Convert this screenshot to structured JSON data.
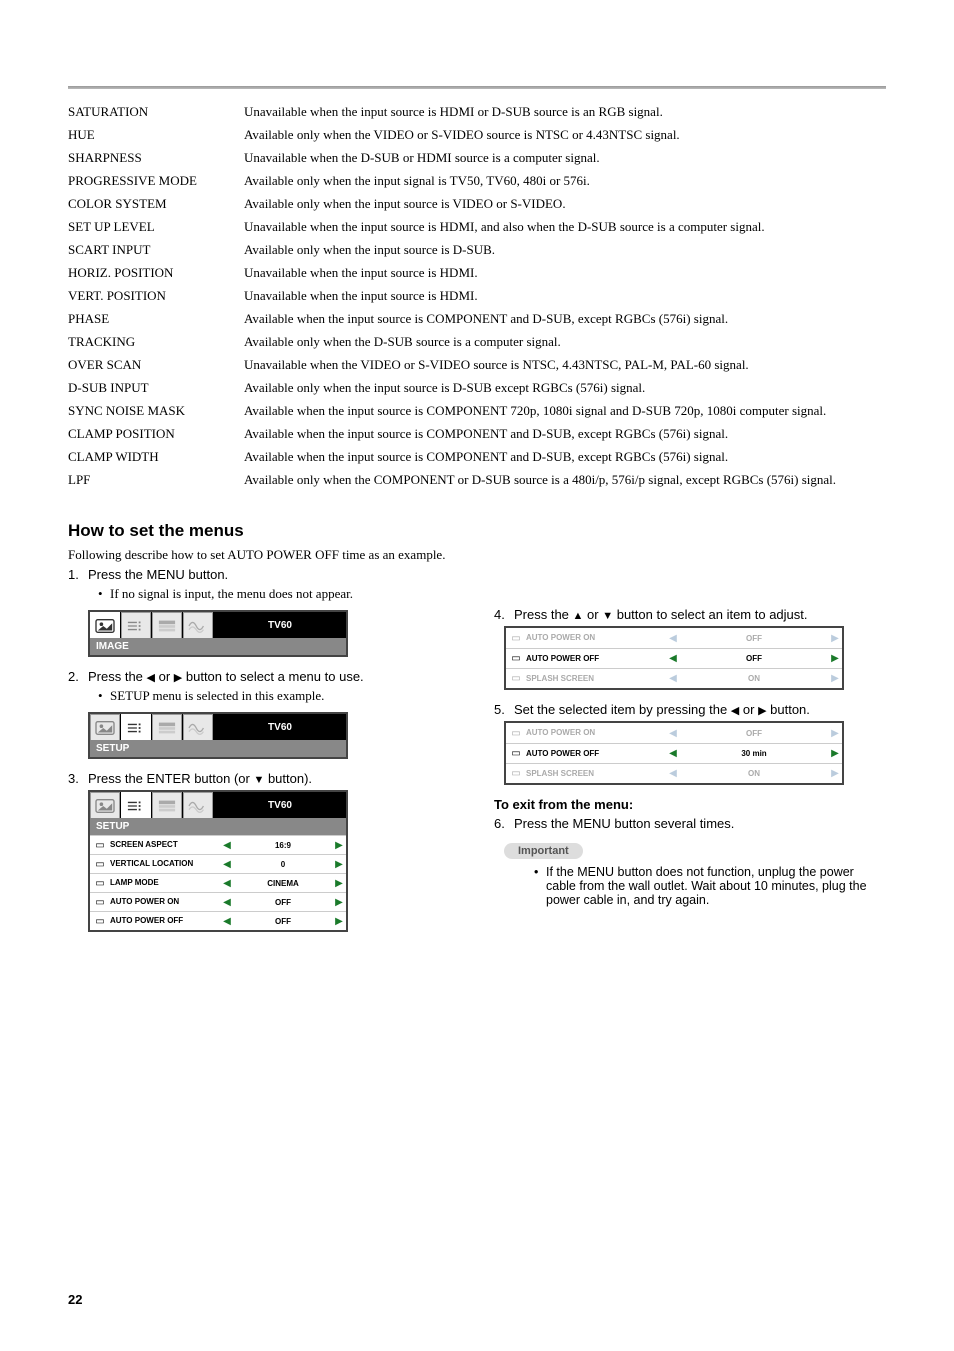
{
  "specs": [
    {
      "key": "SATURATION",
      "val": "Unavailable when the input source is HDMI or D-SUB source is an RGB signal."
    },
    {
      "key": "HUE",
      "val": "Available only when the VIDEO or S-VIDEO source is NTSC or 4.43NTSC signal."
    },
    {
      "key": "SHARPNESS",
      "val": "Unavailable when the D-SUB or HDMI source is a computer signal."
    },
    {
      "key": "PROGRESSIVE MODE",
      "val": "Available only when the input signal is TV50, TV60, 480i or 576i."
    },
    {
      "key": "COLOR SYSTEM",
      "val": "Available only when the input source is VIDEO or S-VIDEO."
    },
    {
      "key": "SET UP LEVEL",
      "val": "Unavailable when the input source is HDMI, and also when the D-SUB source is a computer signal."
    },
    {
      "key": "SCART INPUT",
      "val": "Available only when the input source is D-SUB."
    },
    {
      "key": "HORIZ. POSITION",
      "val": "Unavailable when the input source is HDMI."
    },
    {
      "key": "VERT. POSITION",
      "val": "Unavailable when the input source is HDMI."
    },
    {
      "key": "PHASE",
      "val": "Available when the input source is COMPONENT and D-SUB, except RGBCs (576i) signal."
    },
    {
      "key": "TRACKING",
      "val": "Available only when the D-SUB source is a computer signal."
    },
    {
      "key": "OVER SCAN",
      "val": "Unavailable when the VIDEO or S-VIDEO source is NTSC, 4.43NTSC, PAL-M, PAL-60 signal."
    },
    {
      "key": "D-SUB INPUT",
      "val": "Available only when the input source is D-SUB except RGBCs (576i) signal."
    },
    {
      "key": "SYNC NOISE MASK",
      "val": "Available when the input source is COMPONENT 720p, 1080i signal and D-SUB 720p, 1080i computer signal."
    },
    {
      "key": "CLAMP POSITION",
      "val": "Available when the input source is COMPONENT and D-SUB, except RGBCs (576i) signal."
    },
    {
      "key": "CLAMP WIDTH",
      "val": "Available when the input source is COMPONENT and D-SUB, except RGBCs (576i) signal."
    },
    {
      "key": "LPF",
      "val": "Available only when the COMPONENT or D-SUB source is a 480i/p, 576i/p signal, except RGBCs (576i) signal."
    }
  ],
  "how": {
    "title": "How to set the menus",
    "intro": "Following describe how to set AUTO POWER OFF time as an example.",
    "step1": {
      "num": "1.",
      "text": "Press the MENU button.",
      "note": "If no signal is input, the menu does not appear."
    },
    "osd1": {
      "tablabel": "TV60",
      "bar": "IMAGE"
    },
    "step2": {
      "num": "2.",
      "text_a": "Press the ",
      "text_b": " or ",
      "text_c": " button to select a menu to use.",
      "note": "SETUP menu is selected in this example."
    },
    "osd2": {
      "tablabel": "TV60",
      "bar": "SETUP"
    },
    "step3": {
      "num": "3.",
      "text_a": "Press the ENTER button (or ",
      "text_b": " button)."
    },
    "osd3": {
      "tablabel": "TV60",
      "bar": "SETUP",
      "rows": [
        {
          "label": "SCREEN ASPECT",
          "val": "16:9"
        },
        {
          "label": "VERTICAL LOCATION",
          "val": "0"
        },
        {
          "label": "LAMP MODE",
          "val": "CINEMA"
        },
        {
          "label": "AUTO POWER ON",
          "val": "OFF"
        },
        {
          "label": "AUTO POWER OFF",
          "val": "OFF"
        }
      ]
    },
    "step4": {
      "num": "4.",
      "text_a": "Press the ",
      "text_b": " or ",
      "text_c": " button to select an item to adjust."
    },
    "osd4": {
      "rows": [
        {
          "label": "AUTO POWER ON",
          "val": "OFF",
          "dim": true
        },
        {
          "label": "AUTO POWER OFF",
          "val": "OFF",
          "dim": false
        },
        {
          "label": "SPLASH SCREEN",
          "val": "ON",
          "dim": true
        }
      ]
    },
    "step5": {
      "num": "5.",
      "text_a": "Set the selected item by pressing the ",
      "text_b": " or ",
      "text_c": " button."
    },
    "osd5": {
      "rows": [
        {
          "label": "AUTO POWER ON",
          "val": "OFF",
          "dim": true
        },
        {
          "label": "AUTO POWER OFF",
          "val": "30 min",
          "dim": false
        },
        {
          "label": "SPLASH SCREEN",
          "val": "ON",
          "dim": true
        }
      ]
    },
    "exit_title": "To exit from the menu:",
    "step6": {
      "num": "6.",
      "text": "Press the MENU button several times."
    },
    "important_label": "Important",
    "important_text": "If the MENU button does not function, unplug the power cable from the wall outlet. Wait about 10 minutes, plug the power cable in, and try again."
  },
  "page_number": "22"
}
